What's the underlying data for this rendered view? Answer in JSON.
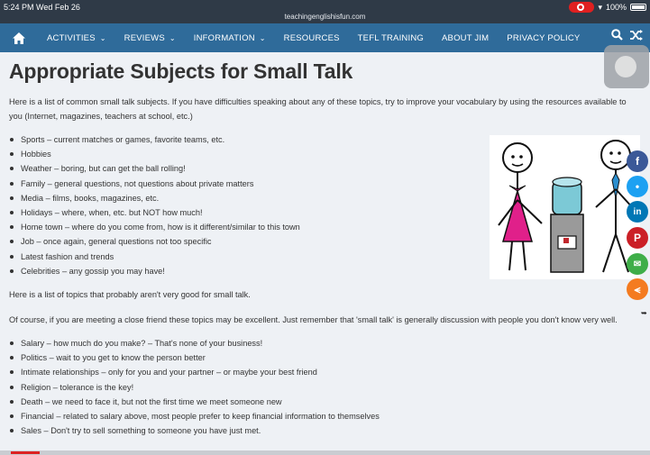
{
  "status": {
    "time_date": "5:24 PM  Wed Feb 26",
    "url": "teachingenglishisfun.com",
    "battery": "100%"
  },
  "nav": {
    "items": [
      {
        "label": "ACTIVITIES",
        "dropdown": true
      },
      {
        "label": "REVIEWS",
        "dropdown": true
      },
      {
        "label": "INFORMATION",
        "dropdown": true
      },
      {
        "label": "RESOURCES",
        "dropdown": false
      },
      {
        "label": "TEFL TRAINING",
        "dropdown": false
      },
      {
        "label": "ABOUT JIM",
        "dropdown": false
      },
      {
        "label": "PRIVACY POLICY",
        "dropdown": false
      }
    ]
  },
  "article": {
    "title": "Appropriate Subjects for Small Talk",
    "intro": "Here is a list of common small talk subjects. If you have difficulties speaking about any of these topics, try to improve your vocabulary by using the resources available to you (Internet, magazines, teachers at school, etc.)",
    "good_topics": [
      "Sports – current matches or games, favorite teams, etc.",
      "Hobbies",
      "Weather – boring, but can get the ball rolling!",
      "Family – general questions, not questions about private matters",
      "Media – films, books, magazines, etc.",
      "Holidays – where, when, etc. but NOT how much!",
      "Home town – where do you come from, how is it different/similar to this town",
      "Job – once again, general questions not too specific",
      "Latest fashion and trends",
      "Celebrities – any gossip you may have!"
    ],
    "bad_intro": "Here is a list of topics that probably aren't very good for small talk.",
    "note": "Of course, if you are meeting a close friend these topics may be excellent. Just remember that 'small talk' is generally discussion with people you don't know very well.",
    "bad_topics": [
      "Salary – how much do you make? – That's none of your business!",
      "Politics – wait to you get to know the person better",
      "Intimate relationships – only for you and your partner – or maybe your best friend",
      "Religion – tolerance is the key!",
      "Death – we need to face it, but not the first time we meet someone new",
      "Financial – related to salary above, most people prefer to keep financial information to themselves",
      "Sales – Don't try to sell something to someone you have just met."
    ]
  },
  "colors": {
    "nav_bg": "#2f6b9a",
    "page_bg": "#eef1f5",
    "dress": "#e0208a"
  }
}
